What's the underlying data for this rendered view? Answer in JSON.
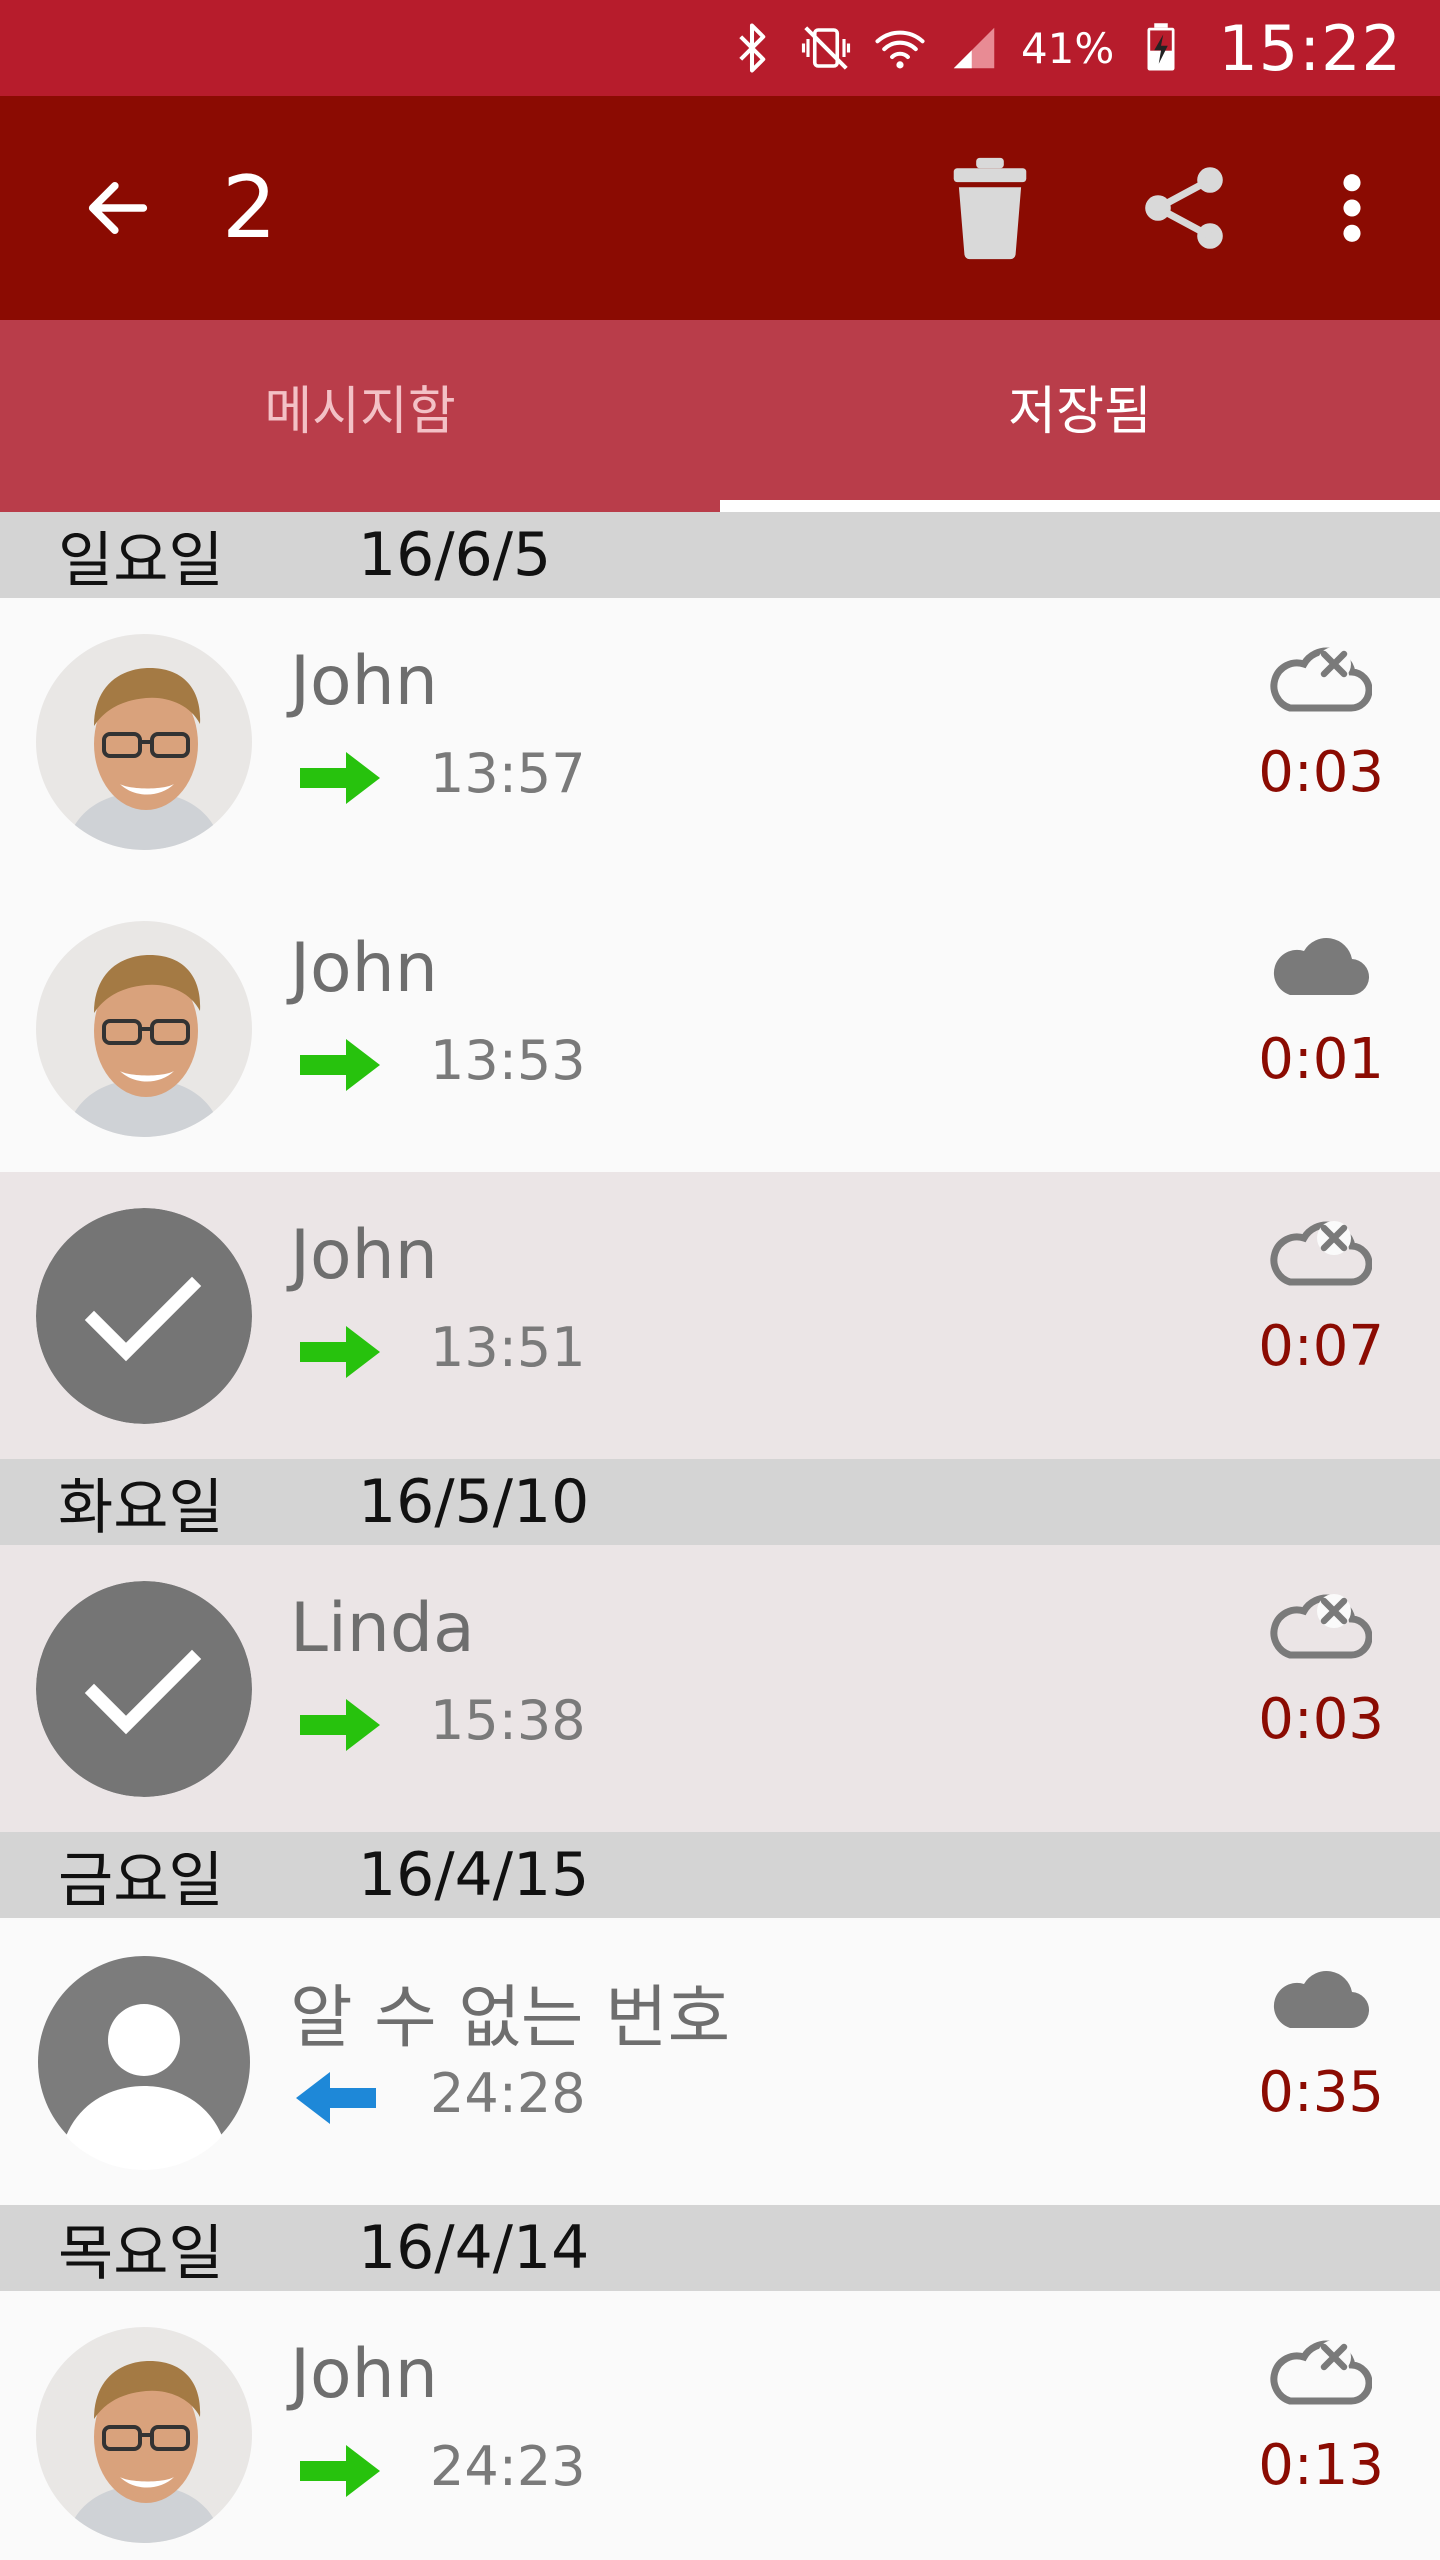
{
  "status_bar": {
    "battery_percent": "41%",
    "time": "15:22"
  },
  "action_bar": {
    "selected_count": "2"
  },
  "tabs": [
    {
      "label": "메시지함",
      "active": false
    },
    {
      "label": "저장됨",
      "active": true
    }
  ],
  "groups": [
    {
      "day": "일요일",
      "date": "16/6/5",
      "items": [
        {
          "name": "John",
          "time": "13:57",
          "duration": "0:03",
          "direction": "outgoing",
          "cloud": "cloud-off-icon",
          "avatar": "photo",
          "selected": false
        },
        {
          "name": "John",
          "time": "13:53",
          "duration": "0:01",
          "direction": "outgoing",
          "cloud": "cloud-icon",
          "avatar": "photo",
          "selected": false
        },
        {
          "name": "John",
          "time": "13:51",
          "duration": "0:07",
          "direction": "outgoing",
          "cloud": "cloud-off-icon",
          "avatar": "check",
          "selected": true
        }
      ]
    },
    {
      "day": "화요일",
      "date": "16/5/10",
      "items": [
        {
          "name": "Linda",
          "time": "15:38",
          "duration": "0:03",
          "direction": "outgoing",
          "cloud": "cloud-off-icon",
          "avatar": "check",
          "selected": true
        }
      ]
    },
    {
      "day": "금요일",
      "date": "16/4/15",
      "items": [
        {
          "name": "알 수 없는 번호",
          "time": "24:28",
          "duration": "0:35",
          "direction": "incoming",
          "cloud": "cloud-icon",
          "avatar": "person",
          "selected": false
        }
      ]
    },
    {
      "day": "목요일",
      "date": "16/4/14",
      "items": [
        {
          "name": "John",
          "time": "24:23",
          "duration": "0:13",
          "direction": "outgoing",
          "cloud": "cloud-off-icon",
          "avatar": "photo",
          "selected": false
        }
      ]
    }
  ],
  "colors": {
    "status_bar": "#b71c2c",
    "action_bar": "#8b0b02",
    "tab_bar": "#b93d4a",
    "outgoing_arrow": "#27c20d",
    "incoming_arrow": "#1e88d8",
    "duration_text": "#8b0b02"
  }
}
